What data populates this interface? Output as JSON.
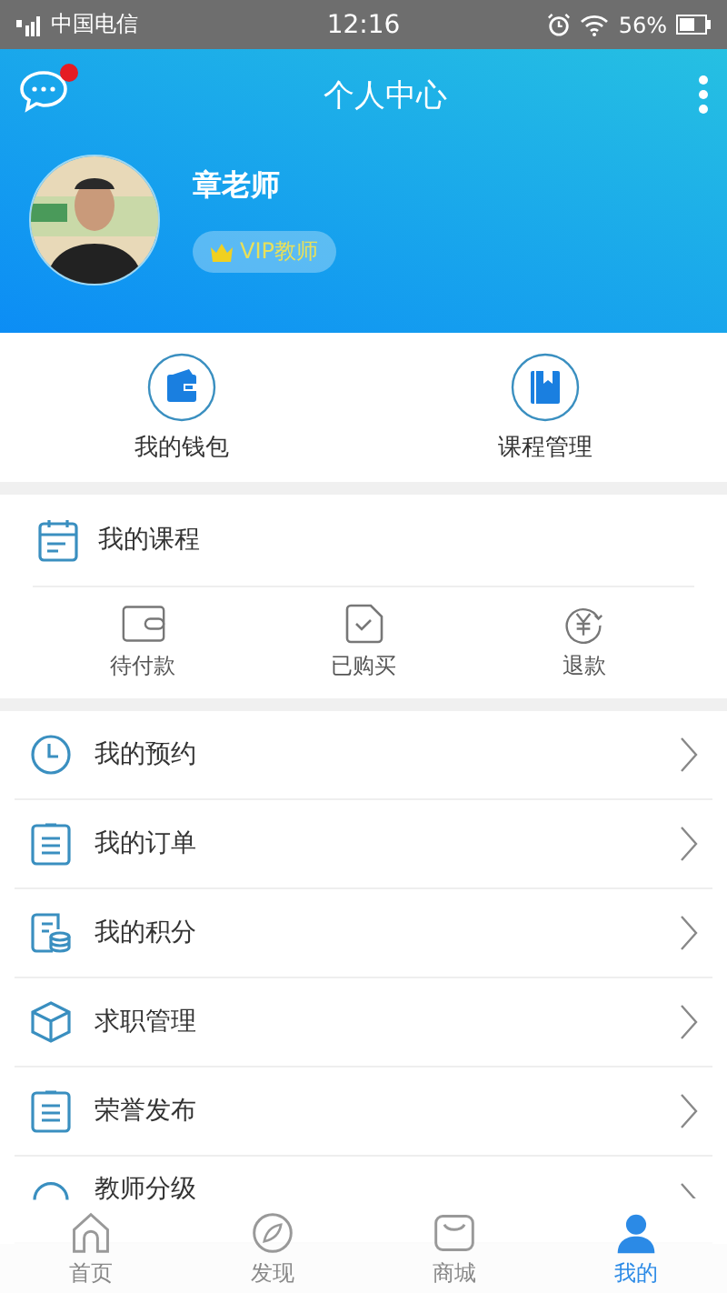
{
  "status_bar": {
    "carrier": "中国电信",
    "time": "12:16",
    "battery": "56%"
  },
  "header": {
    "title": "个人中心",
    "has_unread": true
  },
  "profile": {
    "name": "章老师",
    "badge": "VIP教师"
  },
  "shortcuts": [
    {
      "kind": "wallet",
      "label": "我的钱包"
    },
    {
      "kind": "book",
      "label": "课程管理"
    }
  ],
  "courses": {
    "title": "我的课程",
    "items": [
      {
        "kind": "pending",
        "label": "待付款"
      },
      {
        "kind": "bought",
        "label": "已购买"
      },
      {
        "kind": "refund",
        "label": "退款"
      }
    ]
  },
  "menu": [
    {
      "kind": "clock",
      "label": "我的预约"
    },
    {
      "kind": "order",
      "label": "我的订单"
    },
    {
      "kind": "points",
      "label": "我的积分"
    },
    {
      "kind": "cube",
      "label": "求职管理"
    },
    {
      "kind": "honor",
      "label": "荣誉发布"
    },
    {
      "kind": "level",
      "label": "教师分级"
    }
  ],
  "bottom_nav": [
    {
      "kind": "home",
      "label": "首页",
      "selected": false
    },
    {
      "kind": "discover",
      "label": "发现",
      "selected": false
    },
    {
      "kind": "shop",
      "label": "商城",
      "selected": false
    },
    {
      "kind": "me",
      "label": "我的",
      "selected": true
    }
  ]
}
